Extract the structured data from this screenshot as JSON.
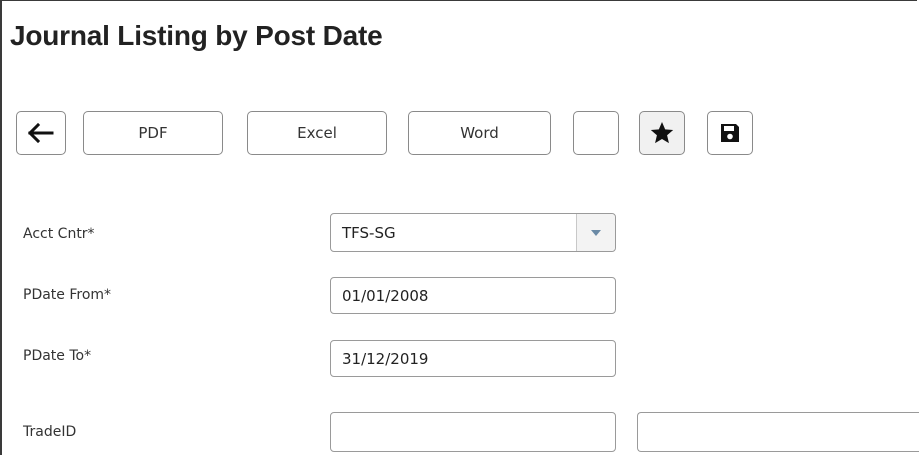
{
  "page": {
    "title": "Journal Listing by Post Date"
  },
  "toolbar": {
    "back_icon": "arrow-left-icon",
    "pdf_label": "PDF",
    "excel_label": "Excel",
    "word_label": "Word",
    "star_icon": "star-icon",
    "save_icon": "floppy-disk-icon"
  },
  "form": {
    "acct_cntr": {
      "label": "Acct Cntr*",
      "value": "TFS-SG"
    },
    "pdate_from": {
      "label": "PDate From*",
      "value": "01/01/2008"
    },
    "pdate_to": {
      "label": "PDate To*",
      "value": "31/12/2019"
    },
    "trade_id": {
      "label": "TradeID",
      "value_from": "",
      "value_to": ""
    }
  },
  "colors": {
    "border": "#8a8a8a",
    "text": "#333333",
    "title": "#222222",
    "arrow": "#6a8aa6"
  }
}
